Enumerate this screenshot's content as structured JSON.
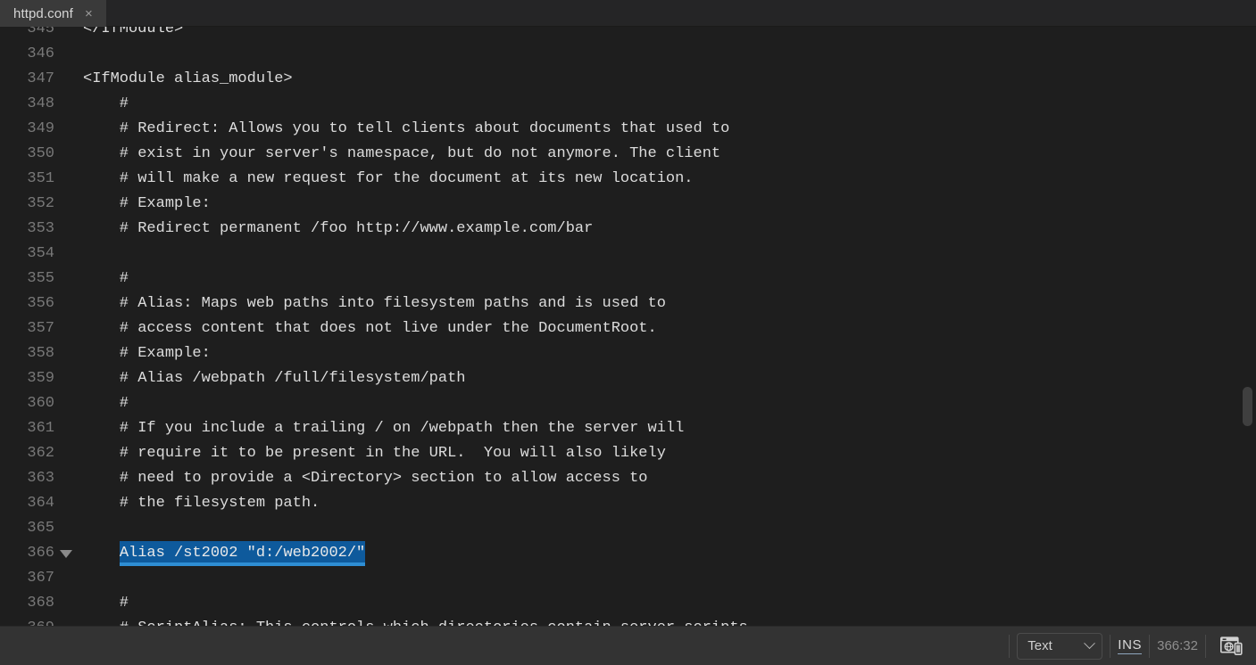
{
  "window": {
    "title": "httpd.conf"
  },
  "tabbar": {
    "tabs": [
      {
        "label": "httpd.conf",
        "close_glyph": "×",
        "active": true
      }
    ]
  },
  "editor": {
    "language": "Apache config",
    "first_visible_line": 345,
    "lines": [
      {
        "number": "345",
        "text": "</IfModule>",
        "fold": false,
        "selected": false
      },
      {
        "number": "346",
        "text": "",
        "fold": false,
        "selected": false
      },
      {
        "number": "347",
        "text": "<IfModule alias_module>",
        "fold": false,
        "selected": false
      },
      {
        "number": "348",
        "text": "    #",
        "fold": false,
        "selected": false
      },
      {
        "number": "349",
        "text": "    # Redirect: Allows you to tell clients about documents that used to",
        "fold": false,
        "selected": false
      },
      {
        "number": "350",
        "text": "    # exist in your server's namespace, but do not anymore. The client",
        "fold": false,
        "selected": false
      },
      {
        "number": "351",
        "text": "    # will make a new request for the document at its new location.",
        "fold": false,
        "selected": false
      },
      {
        "number": "352",
        "text": "    # Example:",
        "fold": false,
        "selected": false
      },
      {
        "number": "353",
        "text": "    # Redirect permanent /foo http://www.example.com/bar",
        "fold": false,
        "selected": false
      },
      {
        "number": "354",
        "text": "",
        "fold": false,
        "selected": false
      },
      {
        "number": "355",
        "text": "    #",
        "fold": false,
        "selected": false
      },
      {
        "number": "356",
        "text": "    # Alias: Maps web paths into filesystem paths and is used to",
        "fold": false,
        "selected": false
      },
      {
        "number": "357",
        "text": "    # access content that does not live under the DocumentRoot.",
        "fold": false,
        "selected": false
      },
      {
        "number": "358",
        "text": "    # Example:",
        "fold": false,
        "selected": false
      },
      {
        "number": "359",
        "text": "    # Alias /webpath /full/filesystem/path",
        "fold": false,
        "selected": false
      },
      {
        "number": "360",
        "text": "    #",
        "fold": false,
        "selected": false
      },
      {
        "number": "361",
        "text": "    # If you include a trailing / on /webpath then the server will",
        "fold": false,
        "selected": false
      },
      {
        "number": "362",
        "text": "    # require it to be present in the URL.  You will also likely",
        "fold": false,
        "selected": false
      },
      {
        "number": "363",
        "text": "    # need to provide a <Directory> section to allow access to",
        "fold": false,
        "selected": false
      },
      {
        "number": "364",
        "text": "    # the filesystem path.",
        "fold": false,
        "selected": false
      },
      {
        "number": "365",
        "text": "",
        "fold": false,
        "selected": false
      },
      {
        "number": "366",
        "text": "    Alias /st2002 \"d:/web2002/\"",
        "fold": true,
        "selected": true,
        "selected_text": "Alias /st2002 \"d:/web2002/\""
      },
      {
        "number": "367",
        "text": "",
        "fold": false,
        "selected": false
      },
      {
        "number": "368",
        "text": "    #",
        "fold": false,
        "selected": false
      },
      {
        "number": "369",
        "text": "    # ScriptAlias: This controls which directories contain server scripts.",
        "fold": false,
        "selected": false
      }
    ]
  },
  "statusbar": {
    "language_label": "Text",
    "insert_mode": "INS",
    "cursor_position": "366:32",
    "preview_icon_name": "browser-preview-icon"
  },
  "colors": {
    "editor_background": "#1e1e1e",
    "tabbar_background": "#252526",
    "active_tab_background": "#3a3a3a",
    "statusbar_background": "#333333",
    "code_foreground": "#dcdcdc",
    "line_number_foreground": "#787878",
    "selection_background": "#0e5a9c",
    "selection_underline": "#2e8ed4",
    "scrollbar_thumb": "#3f3f3f"
  }
}
